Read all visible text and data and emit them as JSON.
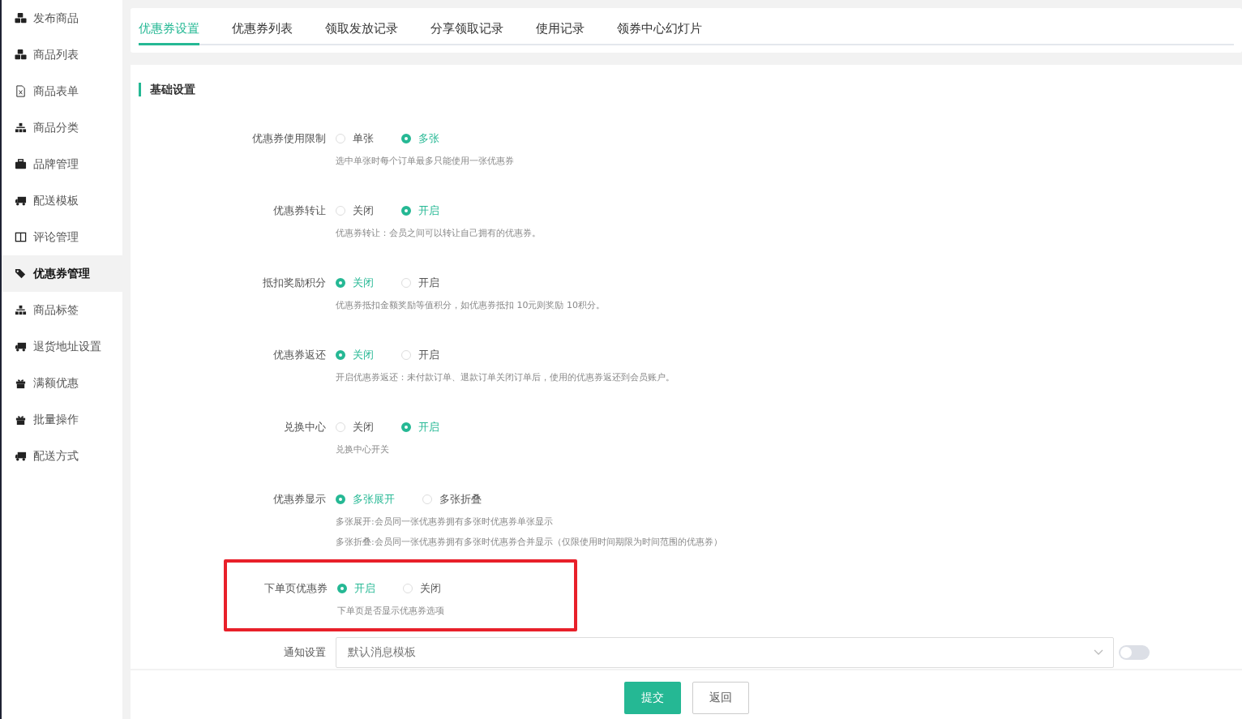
{
  "sidebar": {
    "items": [
      {
        "label": "发布商品",
        "selected": false
      },
      {
        "label": "商品列表",
        "selected": false
      },
      {
        "label": "商品表单",
        "selected": false
      },
      {
        "label": "商品分类",
        "selected": false
      },
      {
        "label": "品牌管理",
        "selected": false
      },
      {
        "label": "配送模板",
        "selected": false
      },
      {
        "label": "评论管理",
        "selected": false
      },
      {
        "label": "优惠券管理",
        "selected": true
      },
      {
        "label": "商品标签",
        "selected": false
      },
      {
        "label": "退货地址设置",
        "selected": false
      },
      {
        "label": "满额优惠",
        "selected": false
      },
      {
        "label": "批量操作",
        "selected": false
      },
      {
        "label": "配送方式",
        "selected": false
      }
    ]
  },
  "tabs": [
    {
      "label": "优惠券设置",
      "selected": true
    },
    {
      "label": "优惠券列表",
      "selected": false
    },
    {
      "label": "领取发放记录",
      "selected": false
    },
    {
      "label": "分享领取记录",
      "selected": false
    },
    {
      "label": "使用记录",
      "selected": false
    },
    {
      "label": "领券中心幻灯片",
      "selected": false
    }
  ],
  "section_title": "基础设置",
  "settings": [
    {
      "label": "优惠券使用限制",
      "highlighted": false,
      "options": [
        {
          "label": "单张",
          "selected": false
        },
        {
          "label": "多张",
          "selected": true
        }
      ],
      "hints": [
        "选中单张时每个订单最多只能使用一张优惠券"
      ]
    },
    {
      "label": "优惠券转让",
      "highlighted": false,
      "options": [
        {
          "label": "关闭",
          "selected": false
        },
        {
          "label": "开启",
          "selected": true
        }
      ],
      "hints": [
        "优惠券转让：会员之间可以转让自己拥有的优惠券。"
      ]
    },
    {
      "label": "抵扣奖励积分",
      "highlighted": false,
      "options": [
        {
          "label": "关闭",
          "selected": true
        },
        {
          "label": "开启",
          "selected": false
        }
      ],
      "hints": [
        "优惠券抵扣金额奖励等值积分，如优惠券抵扣 10元则奖励 10积分。"
      ]
    },
    {
      "label": "优惠券返还",
      "highlighted": false,
      "options": [
        {
          "label": "关闭",
          "selected": true
        },
        {
          "label": "开启",
          "selected": false
        }
      ],
      "hints": [
        "开启优惠券返还：未付款订单、退款订单关闭订单后，使用的优惠券返还到会员账户。"
      ]
    },
    {
      "label": "兑换中心",
      "highlighted": false,
      "options": [
        {
          "label": "关闭",
          "selected": false
        },
        {
          "label": "开启",
          "selected": true
        }
      ],
      "hints": [
        "兑换中心开关"
      ]
    },
    {
      "label": "优惠券显示",
      "highlighted": false,
      "options": [
        {
          "label": "多张展开",
          "selected": true
        },
        {
          "label": "多张折叠",
          "selected": false
        }
      ],
      "hints": [
        "多张展开:会员同一张优惠券拥有多张时优惠券单张显示",
        "多张折叠:会员同一张优惠券拥有多张时优惠券合并显示（仅限使用时间期限为时间范围的优惠券）"
      ]
    },
    {
      "label": "下单页优惠券",
      "highlighted": true,
      "options": [
        {
          "label": "开启",
          "selected": true
        },
        {
          "label": "关闭",
          "selected": false
        }
      ],
      "hints": [
        "下单页是否显示优惠券选项"
      ]
    }
  ],
  "notify": {
    "label": "通知设置",
    "placeholder": "默认消息模板",
    "toggle_on": false
  },
  "buttons": {
    "submit": "提交",
    "back": "返回"
  }
}
